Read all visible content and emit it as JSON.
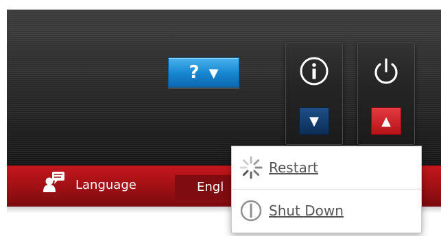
{
  "header": {
    "help_button": {
      "label": "?",
      "caret": "▼",
      "color": "#1e88d4"
    },
    "info_tile": {
      "icon": "info-icon",
      "toggle_caret": "▼",
      "toggle_color": "#0c2e57"
    },
    "power_tile": {
      "icon": "power-icon",
      "toggle_caret": "▲",
      "toggle_color": "#c8151c"
    }
  },
  "language_bar": {
    "icon": "language-chat-icon",
    "label": "Language",
    "selected_value": "Engl",
    "bar_color": "#a51217"
  },
  "power_menu": {
    "items": [
      {
        "label": "Restart",
        "icon": "restart-spinner-icon"
      },
      {
        "label": "Shut Down",
        "icon": "shutdown-icon"
      }
    ]
  }
}
